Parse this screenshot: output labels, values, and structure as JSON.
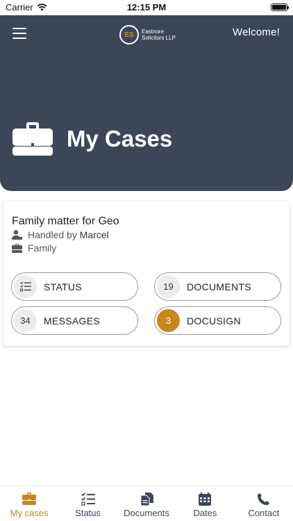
{
  "status_bar": {
    "carrier": "Carrier",
    "time": "12:15 PM"
  },
  "header": {
    "logo_initials": "ES",
    "logo_name_line1": "Eastnore",
    "logo_name_line2": "Solicitors LLP",
    "welcome": "Welcome!",
    "page_title": "My Cases",
    "background_color": "#3d4659",
    "accent_color": "#c8861f"
  },
  "case": {
    "title": "Family matter for Geo",
    "handled_by_prefix": "Handled by",
    "handler_name": "Marcel",
    "area": "Family",
    "buttons": [
      {
        "label": "STATUS",
        "icon": "checklist-icon"
      },
      {
        "label": "DOCUMENTS",
        "count": "19"
      },
      {
        "label": "MESSAGES",
        "count": "34"
      },
      {
        "label": "DOCUSIGN",
        "count": "3"
      }
    ]
  },
  "tabs": [
    {
      "label": "My cases",
      "icon": "briefcase-icon",
      "active": true
    },
    {
      "label": "Status",
      "icon": "checklist-icon"
    },
    {
      "label": "Documents",
      "icon": "documents-icon"
    },
    {
      "label": "Dates",
      "icon": "calendar-icon"
    },
    {
      "label": "Contact",
      "icon": "phone-icon"
    }
  ]
}
